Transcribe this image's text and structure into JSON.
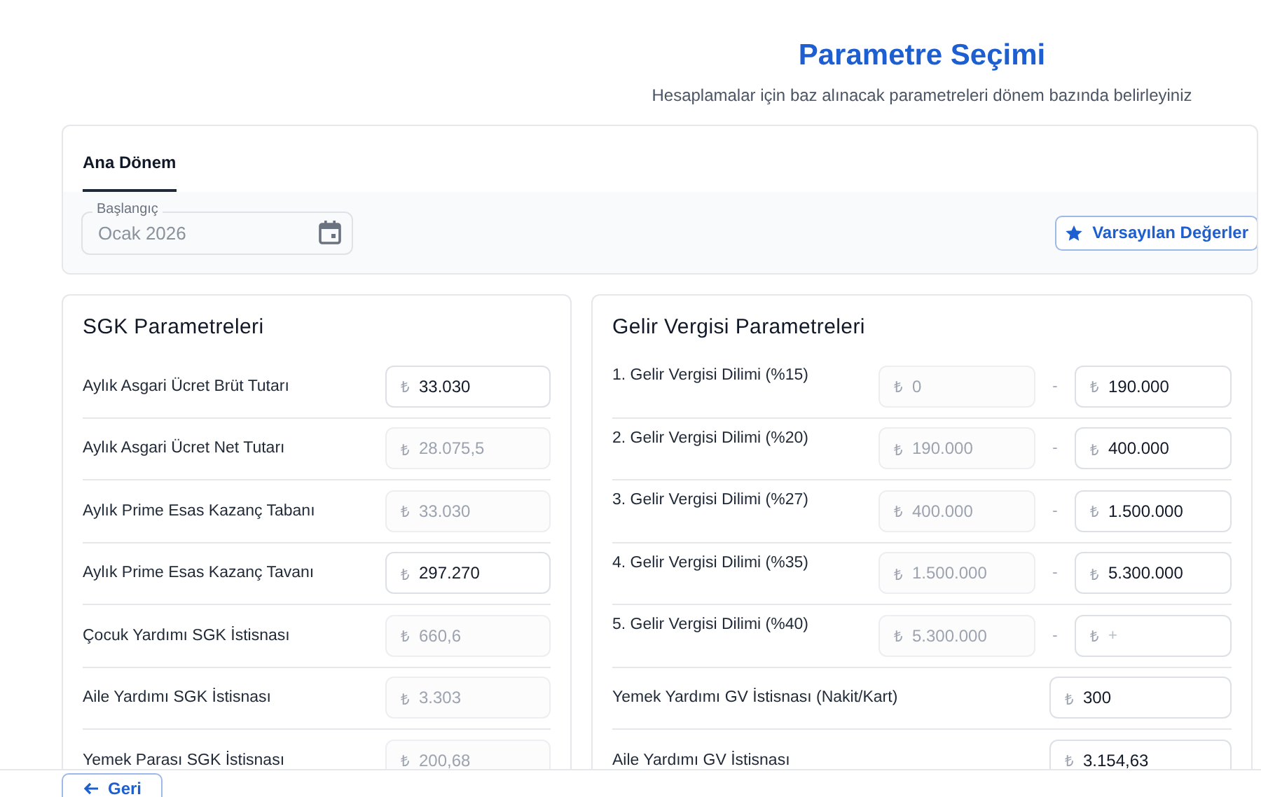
{
  "header": {
    "title": "Parametre Seçimi",
    "subtitle": "Hesaplamalar için baz alınacak parametreleri dönem bazında belirleyiniz"
  },
  "period": {
    "tabs": [
      {
        "label": "Ana Dönem",
        "selected": true
      }
    ],
    "start_field": {
      "label": "Başlangıç",
      "value": "Ocak 2026"
    },
    "defaults_button": "Varsayılan Değerler"
  },
  "sgk": {
    "title": "SGK Parametreleri",
    "rows": [
      {
        "label": "Aylık Asgari Ücret Brüt Tutarı",
        "prefix": "₺",
        "value": "33.030",
        "disabled": false
      },
      {
        "label": "Aylık Asgari Ücret Net Tutarı",
        "prefix": "₺",
        "value": "28.075,5",
        "disabled": true
      },
      {
        "label": "Aylık Prime Esas Kazanç Tabanı",
        "prefix": "₺",
        "value": "33.030",
        "disabled": true
      },
      {
        "label": "Aylık Prime Esas Kazanç Tavanı",
        "prefix": "₺",
        "value": "297.270",
        "disabled": false
      },
      {
        "label": "Çocuk Yardımı SGK İstisnası",
        "prefix": "₺",
        "value": "660,6",
        "disabled": true
      },
      {
        "label": "Aile Yardımı SGK İstisnası",
        "prefix": "₺",
        "value": "3.303",
        "disabled": true
      },
      {
        "label": "Yemek Parası SGK İstisnası",
        "prefix": "₺",
        "value": "200,68",
        "disabled": true
      }
    ]
  },
  "income_tax": {
    "title": "Gelir Vergisi Parametreleri",
    "brackets": [
      {
        "label": "1. Gelir Vergisi Dilimi (%15)",
        "from": {
          "prefix": "₺",
          "value": "0",
          "disabled": true
        },
        "separator": "-",
        "to": {
          "prefix": "₺",
          "value": "190.000",
          "disabled": false
        }
      },
      {
        "label": "2. Gelir Vergisi Dilimi (%20)",
        "from": {
          "prefix": "₺",
          "value": "190.000",
          "disabled": true
        },
        "separator": "-",
        "to": {
          "prefix": "₺",
          "value": "400.000",
          "disabled": false
        }
      },
      {
        "label": "3. Gelir Vergisi Dilimi (%27)",
        "from": {
          "prefix": "₺",
          "value": "400.000",
          "disabled": true
        },
        "separator": "-",
        "to": {
          "prefix": "₺",
          "value": "1.500.000",
          "disabled": false
        }
      },
      {
        "label": "4. Gelir Vergisi Dilimi (%35)",
        "from": {
          "prefix": "₺",
          "value": "1.500.000",
          "disabled": true
        },
        "separator": "-",
        "to": {
          "prefix": "₺",
          "value": "5.300.000",
          "disabled": false
        }
      },
      {
        "label": "5. Gelir Vergisi Dilimi (%40)",
        "from": {
          "prefix": "₺",
          "value": "5.300.000",
          "disabled": true
        },
        "separator": "-",
        "to": {
          "prefix": "₺",
          "placeholder": "+",
          "disabled": false
        }
      }
    ],
    "rows": [
      {
        "label": "Yemek Yardımı GV İstisnası (Nakit/Kart)",
        "prefix": "₺",
        "value": "300",
        "disabled": false
      },
      {
        "label": "Aile Yardımı GV İstisnası",
        "prefix": "₺",
        "value": "3.154,63",
        "disabled": false
      }
    ]
  },
  "footer": {
    "back_button": "Geri"
  }
}
